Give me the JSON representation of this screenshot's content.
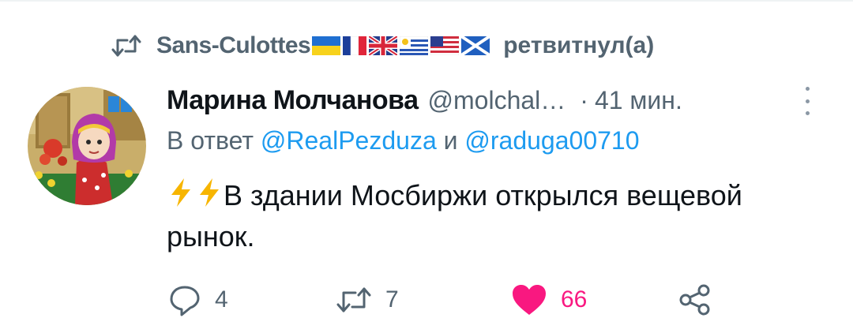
{
  "retweet": {
    "icon": "retweet-icon",
    "user": "Sans-Culottes",
    "flags": [
      "flag-ukraine",
      "flag-france",
      "flag-uk",
      "flag-uruguay",
      "flag-usa",
      "flag-scotland"
    ],
    "label": "ретвитнул(а)"
  },
  "tweet": {
    "display_name": "Марина Молчанова",
    "handle": "@molchal…",
    "separator": "·",
    "time": "41 мин.",
    "reply_prefix": "В ответ",
    "reply_mention_1": "@RealPezduza",
    "reply_conj": "и",
    "reply_mention_2": "@raduga00710",
    "text": "В здании Мосбиржи открылся вещевой рынок."
  },
  "actions": {
    "reply_count": "4",
    "retweet_count": "7",
    "like_count": "66"
  },
  "colors": {
    "accent": "#1d9bf0",
    "muted": "#536471",
    "like": "#f91880",
    "text": "#0f1419"
  }
}
